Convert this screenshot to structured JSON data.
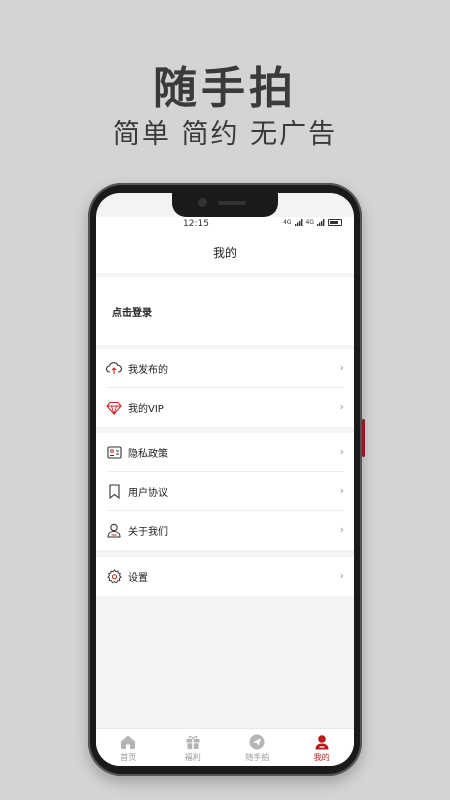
{
  "promo": {
    "title": "随手拍",
    "subtitle": "简单 简约 无广告"
  },
  "status_bar": {
    "time": "12:15",
    "signal1": "4G",
    "signal2": "4G"
  },
  "header": {
    "title": "我的"
  },
  "login": {
    "label": "点击登录"
  },
  "groups": {
    "g1": [
      {
        "label": "我发布的",
        "icon": "cloud-upload-icon"
      },
      {
        "label": "我的VIP",
        "icon": "diamond-icon"
      }
    ],
    "g2": [
      {
        "label": "隐私政策",
        "icon": "id-card-icon"
      },
      {
        "label": "用户协议",
        "icon": "bookmark-icon"
      },
      {
        "label": "关于我们",
        "icon": "user-icon"
      }
    ],
    "g3": [
      {
        "label": "设置",
        "icon": "gear-icon"
      }
    ]
  },
  "chevron": "›",
  "tabs": [
    {
      "label": "首页",
      "icon": "home-icon",
      "active": false
    },
    {
      "label": "福利",
      "icon": "gift-icon",
      "active": false
    },
    {
      "label": "随手拍",
      "icon": "send-icon",
      "active": false
    },
    {
      "label": "我的",
      "icon": "profile-icon",
      "active": true
    }
  ],
  "colors": {
    "accent": "#b71c1c",
    "background": "#d4d4d4",
    "inactive": "#999999"
  }
}
